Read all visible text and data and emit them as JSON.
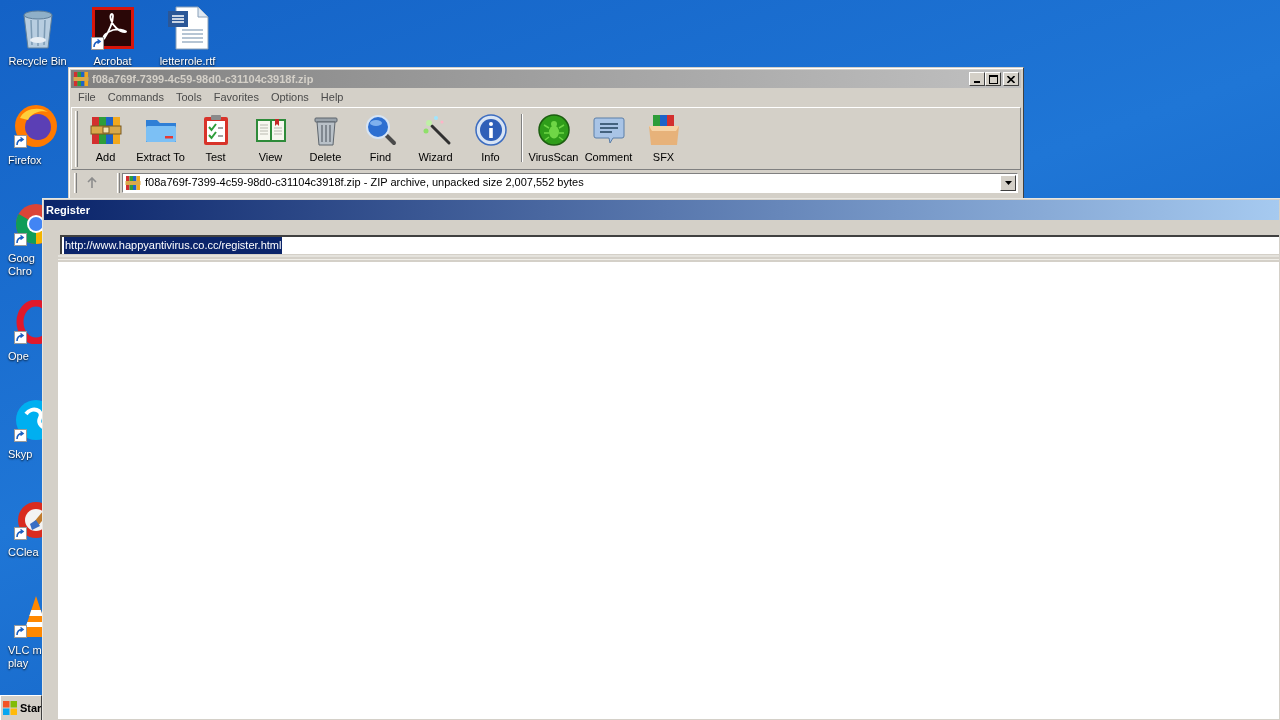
{
  "desktop": {
    "top_icons": [
      {
        "kind": "trash",
        "label": [
          "Recycle Bin"
        ],
        "shortcut": false
      },
      {
        "kind": "tile",
        "label": [
          "Acrobat"
        ],
        "shortcut": true
      },
      {
        "kind": "document",
        "label": [
          "letterrole.rtf"
        ],
        "shortcut": false
      }
    ],
    "side_icons": [
      {
        "kind": "globe",
        "label": [
          "Firefox"
        ],
        "shortcut": true
      },
      {
        "kind": "ring",
        "label": [
          "Goog",
          "Chro"
        ],
        "shortcut": true
      },
      {
        "kind": "oval",
        "label": [
          "Ope"
        ],
        "shortcut": true
      },
      {
        "kind": "swirl",
        "label": [
          "Skyp"
        ],
        "shortcut": true
      },
      {
        "kind": "brush",
        "label": [
          "CClea"
        ],
        "shortcut": true
      },
      {
        "kind": "cone",
        "label": [
          "VLC m",
          "play"
        ],
        "shortcut": true
      }
    ]
  },
  "start_button": {
    "label": "Star"
  },
  "archive_window": {
    "title": "f08a769f-7399-4c59-98d0-c31104c3918f.zip",
    "active": false,
    "menu": [
      "File",
      "Commands",
      "Tools",
      "Favorites",
      "Options",
      "Help"
    ],
    "toolbar": [
      [
        {
          "kind": "books",
          "label": "Add"
        },
        {
          "kind": "folder",
          "label": "Extract To"
        },
        {
          "kind": "clipboard",
          "label": "Test"
        },
        {
          "kind": "book",
          "label": "View"
        },
        {
          "kind": "trash",
          "label": "Delete"
        },
        {
          "kind": "magnifier",
          "label": "Find"
        },
        {
          "kind": "wand",
          "label": "Wizard"
        },
        {
          "kind": "info",
          "label": "Info"
        }
      ],
      [
        {
          "kind": "bug",
          "label": "VirusScan"
        },
        {
          "kind": "speech",
          "label": "Comment"
        },
        {
          "kind": "box",
          "label": "SFX"
        }
      ]
    ],
    "address": "f08a769f-7399-4c59-98d0-c31104c3918f.zip - ZIP archive, unpacked size 2,007,552 bytes"
  },
  "register_window": {
    "title": "Register",
    "active": true,
    "url_field": {
      "value": "http://www.happyantivirus.co.cc/register.html",
      "selected": true
    }
  }
}
